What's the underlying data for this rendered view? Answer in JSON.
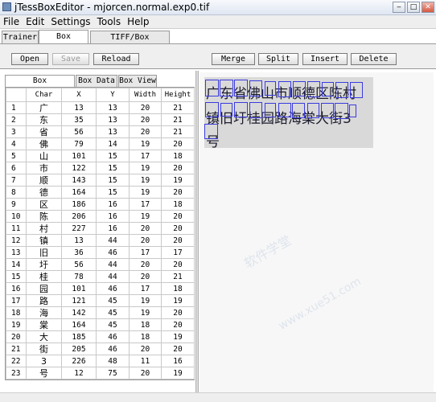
{
  "window": {
    "title": "jTessBoxEditor - mjorcen.normal.exp0.tif"
  },
  "menu": [
    "File",
    "Edit",
    "Settings",
    "Tools",
    "Help"
  ],
  "main_tabs": [
    "Trainer",
    "Box Editor",
    "TIFF/Box Generator"
  ],
  "toolbar": {
    "open": "Open",
    "save": "Save",
    "reload": "Reload",
    "merge": "Merge",
    "split": "Split",
    "insert": "Insert",
    "delete": "Delete"
  },
  "sub_tabs": [
    "Box Coordinates",
    "Box Data",
    "Box View"
  ],
  "table": {
    "columns": [
      "",
      "Char",
      "X",
      "Y",
      "Width",
      "Height"
    ],
    "rows": [
      [
        "1",
        "广",
        "13",
        "13",
        "20",
        "21"
      ],
      [
        "2",
        "东",
        "35",
        "13",
        "20",
        "21"
      ],
      [
        "3",
        "省",
        "56",
        "13",
        "20",
        "21"
      ],
      [
        "4",
        "佛",
        "79",
        "14",
        "19",
        "20"
      ],
      [
        "5",
        "山",
        "101",
        "15",
        "17",
        "18"
      ],
      [
        "6",
        "市",
        "122",
        "15",
        "19",
        "20"
      ],
      [
        "7",
        "顺",
        "143",
        "15",
        "19",
        "19"
      ],
      [
        "8",
        "德",
        "164",
        "15",
        "19",
        "20"
      ],
      [
        "9",
        "区",
        "186",
        "16",
        "17",
        "18"
      ],
      [
        "10",
        "陈",
        "206",
        "16",
        "19",
        "20"
      ],
      [
        "11",
        "村",
        "227",
        "16",
        "20",
        "20"
      ],
      [
        "12",
        "镇",
        "13",
        "44",
        "20",
        "20"
      ],
      [
        "13",
        "旧",
        "36",
        "46",
        "17",
        "17"
      ],
      [
        "14",
        "圩",
        "56",
        "44",
        "20",
        "20"
      ],
      [
        "15",
        "桂",
        "78",
        "44",
        "20",
        "21"
      ],
      [
        "16",
        "园",
        "101",
        "46",
        "17",
        "18"
      ],
      [
        "17",
        "路",
        "121",
        "45",
        "19",
        "19"
      ],
      [
        "18",
        "海",
        "142",
        "45",
        "19",
        "20"
      ],
      [
        "19",
        "棠",
        "164",
        "45",
        "18",
        "20"
      ],
      [
        "20",
        "大",
        "185",
        "46",
        "18",
        "19"
      ],
      [
        "21",
        "街",
        "205",
        "46",
        "20",
        "20"
      ],
      [
        "22",
        "3",
        "226",
        "48",
        "11",
        "16"
      ],
      [
        "23",
        "号",
        "12",
        "75",
        "20",
        "19"
      ]
    ]
  },
  "image": {
    "lines": [
      "广东省佛山市顺德区陈村",
      "镇旧圩桂园路海棠大街3",
      "号"
    ]
  },
  "watermark": {
    "text1": "软件学堂",
    "text2": "www.xue51.com"
  }
}
